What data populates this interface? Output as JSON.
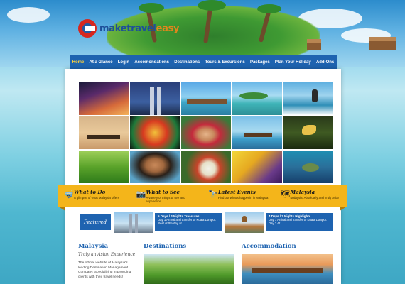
{
  "brand": {
    "name_part1": "maketravel",
    "name_part2": "easy"
  },
  "nav": [
    "Home",
    "At a Glance",
    "Login",
    "Accomondations",
    "Destinations",
    "Tours & Excursions",
    "Packages",
    "Plan Your Holiday",
    "Add-Ons"
  ],
  "features": [
    {
      "title": "What to Do",
      "text": "A glimpse of what Malaysia offers",
      "icon": "diver-icon"
    },
    {
      "title": "What to See",
      "text": "A variety of things to see and experience",
      "icon": "camera-icon"
    },
    {
      "title": "Latest Events",
      "text": "Find out what's happenin in Malaysia",
      "icon": "binoculars-icon"
    },
    {
      "title": "Malaysia",
      "text": "Malaysia, Absolutely and Truly Asia!",
      "icon": "map-icon"
    }
  ],
  "featured": {
    "label": "Featured",
    "items": [
      {
        "title": "5 Days / 4 Nights Treasures",
        "desc": "Day 1 Arrival and transfer to Kuala Lumpur. Rest of the day at"
      },
      {
        "title": "4 Days / 3 Nights Highlights",
        "desc": "Day 1 Arrival and transfer to Kuala Lumpur. Day 2 At"
      }
    ]
  },
  "malaysia": {
    "title": "Malaysia",
    "subtitle": "Truly an Asian Experience",
    "text": "The official website of Malaysia's leading Destination Management Company, Specializing in providing clients with their travel needs!"
  },
  "destinations": {
    "title": "Destinations"
  },
  "accommodation": {
    "title": "Accommodation"
  }
}
